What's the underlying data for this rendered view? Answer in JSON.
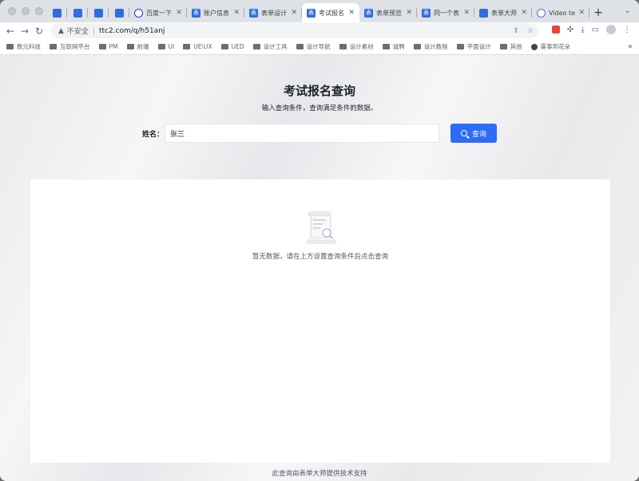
{
  "browser": {
    "tabs": [
      {
        "label": "",
        "icon": "app-icon",
        "active": false
      },
      {
        "label": "",
        "icon": "app-icon",
        "active": false
      },
      {
        "label": "",
        "icon": "app-icon",
        "active": false
      },
      {
        "label": "",
        "icon": "app-icon",
        "active": false
      },
      {
        "label": "百度一下",
        "icon": "baidu-icon",
        "active": false
      },
      {
        "label": "账户信息",
        "icon": "form-icon",
        "active": false
      },
      {
        "label": "表单设计",
        "icon": "form-icon",
        "active": false
      },
      {
        "label": "考试报名",
        "icon": "form-icon",
        "active": true
      },
      {
        "label": "表单预览",
        "icon": "form-icon",
        "active": false
      },
      {
        "label": "同一个表",
        "icon": "form-icon",
        "active": false
      },
      {
        "label": "表单大师",
        "icon": "doc-icon",
        "active": false
      },
      {
        "label": "Video te",
        "icon": "video-icon",
        "active": false
      }
    ],
    "favicon_char": "表",
    "address": {
      "security_label": "不安全",
      "url": "ttc2.com/q/h51anj"
    },
    "bookmarks": [
      {
        "label": "数元科技",
        "icon": "folder-icon"
      },
      {
        "label": "互联网平台",
        "icon": "folder-icon"
      },
      {
        "label": "PM",
        "icon": "folder-icon"
      },
      {
        "label": "前端",
        "icon": "folder-icon"
      },
      {
        "label": "UI",
        "icon": "folder-icon"
      },
      {
        "label": "UE\\UX",
        "icon": "folder-icon"
      },
      {
        "label": "UED",
        "icon": "folder-icon"
      },
      {
        "label": "设计工具",
        "icon": "folder-icon"
      },
      {
        "label": "设计导航",
        "icon": "folder-icon"
      },
      {
        "label": "设计素材",
        "icon": "folder-icon"
      },
      {
        "label": "诚聘",
        "icon": "folder-icon"
      },
      {
        "label": "设计教程",
        "icon": "folder-icon"
      },
      {
        "label": "平面设计",
        "icon": "folder-icon"
      },
      {
        "label": "其他",
        "icon": "folder-icon"
      },
      {
        "label": "雾事到花朵",
        "icon": "globe-icon"
      }
    ]
  },
  "page": {
    "title": "考试报名查询",
    "subtitle": "输入查询条件，查询满足条件的数据。",
    "name_label": "姓名：",
    "name_value": "张三",
    "query_button": "查询",
    "empty_text": "暂无数据，请在上方设置查询条件后点击查询",
    "footer": "此查询由表单大师提供技术支持"
  },
  "colors": {
    "primary": "#2c6cf6",
    "tab_favicon": "#2f6de1"
  }
}
